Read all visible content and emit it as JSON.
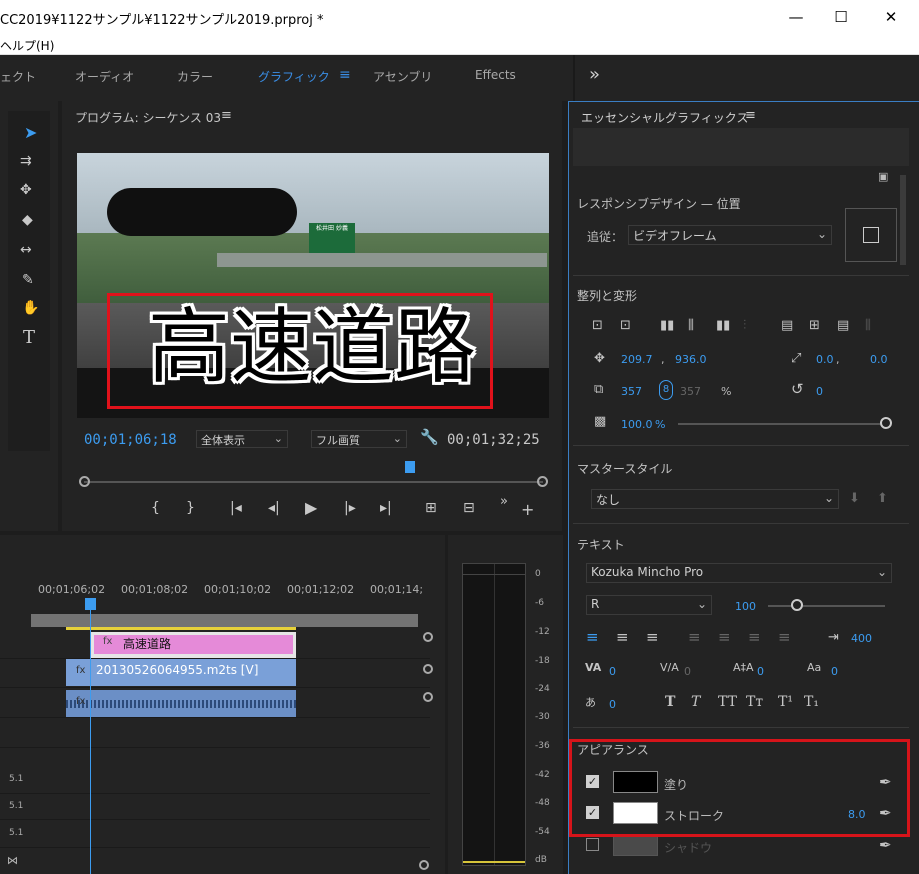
{
  "window": {
    "title": "CC2019¥1122サンプル¥1122サンプル2019.prproj *",
    "minimize": "—",
    "maximize": "☐",
    "close": "✕",
    "menu_help": "ヘルプ(H)"
  },
  "workspaces": {
    "tabs": [
      "ェクト",
      "オーディオ",
      "カラー",
      "グラフィック",
      "アセンブリ",
      "Effects"
    ],
    "active": "グラフィック",
    "more": "»"
  },
  "program_monitor": {
    "title": "プログラム: シーケンス 03",
    "video_caption": "高速道路",
    "sign_text": "松井田 妙義",
    "timecode_current": "00;01;06;18",
    "fit_select": "全体表示",
    "quality_select": "フル画質",
    "timecode_duration": "00;01;32;25"
  },
  "timeline": {
    "ruler_labels": [
      "00;01;06;02",
      "00;01;08;02",
      "00;01;10;02",
      "00;01;12;02",
      "00;01;14;"
    ],
    "clips": {
      "graphic": "高速道路",
      "video": "20130526064955.m2ts [V]"
    },
    "track_labels": [
      "5.1",
      "5.1",
      "5.1"
    ]
  },
  "meter": {
    "scale": [
      "0",
      "-6",
      "-12",
      "-18",
      "-24",
      "-30",
      "-36",
      "-42",
      "-48",
      "-54",
      "dB"
    ]
  },
  "essential_graphics": {
    "title": "エッセンシャルグラフィックス",
    "responsive": {
      "title": "レスポンシブデザイン — 位置",
      "follow_label": "追従：",
      "follow_value": "ビデオフレーム"
    },
    "align": {
      "title": "整列と変形",
      "pos_x": "209.7",
      "pos_y": "936.0",
      "anchor_x": "0.0",
      "anchor_y": "0.0",
      "scale": "357",
      "scale_linked": "357",
      "scale_unit": "%",
      "rotation": "0",
      "opacity": "100.0",
      "opacity_unit": "%"
    },
    "master_style": {
      "title": "マスタースタイル",
      "value": "なし"
    },
    "text": {
      "title": "テキスト",
      "font": "Kozuka Mincho Pro",
      "style": "R",
      "size": "100",
      "tracking_right": "400",
      "kerning": "0",
      "tracking": "0",
      "leading": "0",
      "baseline": "0",
      "tsume": "0",
      "style_buttons": [
        "T",
        "T",
        "TT",
        "Tт",
        "T¹",
        "T₁"
      ]
    },
    "appearance": {
      "title": "アピアランス",
      "fill_label": "塗り",
      "fill_color": "#000000",
      "stroke_label": "ストローク",
      "stroke_color": "#ffffff",
      "stroke_width": "8.0",
      "shadow_label": "シャドウ"
    }
  }
}
